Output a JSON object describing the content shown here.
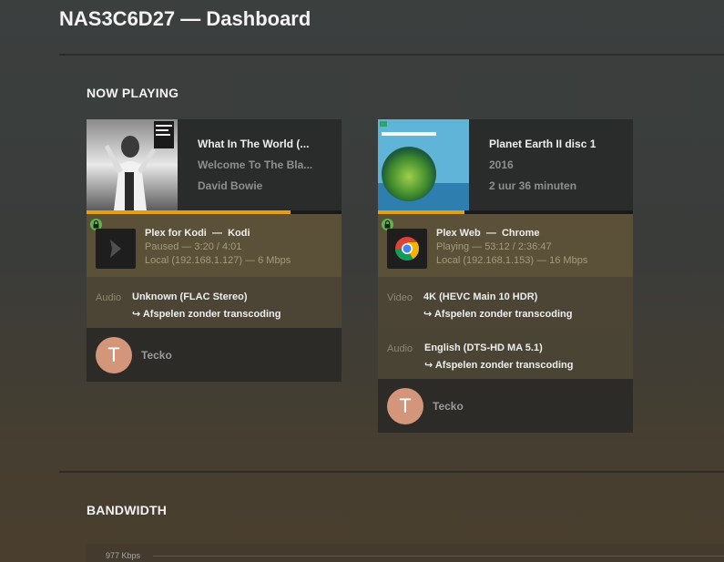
{
  "page": {
    "title": "NAS3C6D27 — Dashboard"
  },
  "now_playing": {
    "title": "NOW PLAYING",
    "sessions": [
      {
        "media_title": "What In The World (...",
        "media_subtitle": "Welcome To The Bla...",
        "media_detail": "David Bowie",
        "progress_fraction": 0.8,
        "player_name": "Plex for Kodi",
        "player_separator": "—",
        "player_product": "Kodi",
        "state_line": "Paused — 3:20 / 4:01",
        "network_line": "Local (192.168.1.127) — 6 Mbps",
        "streams": [
          {
            "label": "Audio",
            "value": "Unknown (FLAC Stereo)",
            "decision": "↪  Afspelen zonder transcoding"
          }
        ],
        "user_initial": "T",
        "user_name": "Tecko",
        "icon": "kodi-icon"
      },
      {
        "media_title": "Planet Earth II disc 1",
        "media_subtitle": "2016",
        "media_detail": "2 uur 36 minuten",
        "progress_fraction": 0.34,
        "player_name": "Plex Web",
        "player_separator": "—",
        "player_product": "Chrome",
        "state_line": "Playing — 53:12 / 2:36:47",
        "network_line": "Local (192.168.1.153) — 16 Mbps",
        "streams": [
          {
            "label": "Video",
            "value": "4K (HEVC Main 10 HDR)",
            "decision": "↪  Afspelen zonder transcoding"
          },
          {
            "label": "Audio",
            "value": "English (DTS-HD MA 5.1)",
            "decision": "↪  Afspelen zonder transcoding"
          }
        ],
        "user_initial": "T",
        "user_name": "Tecko",
        "icon": "chrome-icon"
      }
    ]
  },
  "bandwidth": {
    "title": "BANDWIDTH",
    "axis_label": "977 Kbps"
  },
  "colors": {
    "progress_accent": "#e5a00d",
    "lock_green": "#5fb74c",
    "avatar": "#d4967a"
  }
}
